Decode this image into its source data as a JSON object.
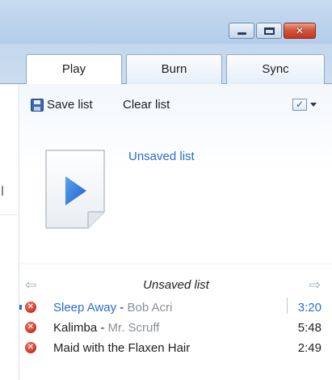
{
  "window": {
    "close_glyph": "✕"
  },
  "tabs": [
    {
      "label": "Play",
      "active": true
    },
    {
      "label": "Burn",
      "active": false
    },
    {
      "label": "Sync",
      "active": false
    }
  ],
  "toolbar": {
    "save_label": "Save list",
    "clear_label": "Clear list",
    "options_glyph": "✓"
  },
  "playlist": {
    "title": "Unsaved list",
    "nav_label": "Unsaved list",
    "nav_prev_glyph": "⇦",
    "nav_next_glyph": "⇨"
  },
  "tracks": [
    {
      "title": "Sleep Away",
      "separator": " - ",
      "artist": "Bob Acri",
      "duration": "3:20",
      "status": "error",
      "playing": true
    },
    {
      "title": "Kalimba",
      "separator": " - ",
      "artist": "Mr. Scruff",
      "duration": "5:48",
      "status": "error",
      "playing": false
    },
    {
      "title": "Maid with the Flaxen Hair",
      "separator": "",
      "artist": "",
      "duration": "2:49",
      "status": "error",
      "playing": false
    }
  ],
  "colors": {
    "accent_blue": "#2a6bd1",
    "error_red": "#c8301f",
    "titlebar": "#bad2ec"
  }
}
